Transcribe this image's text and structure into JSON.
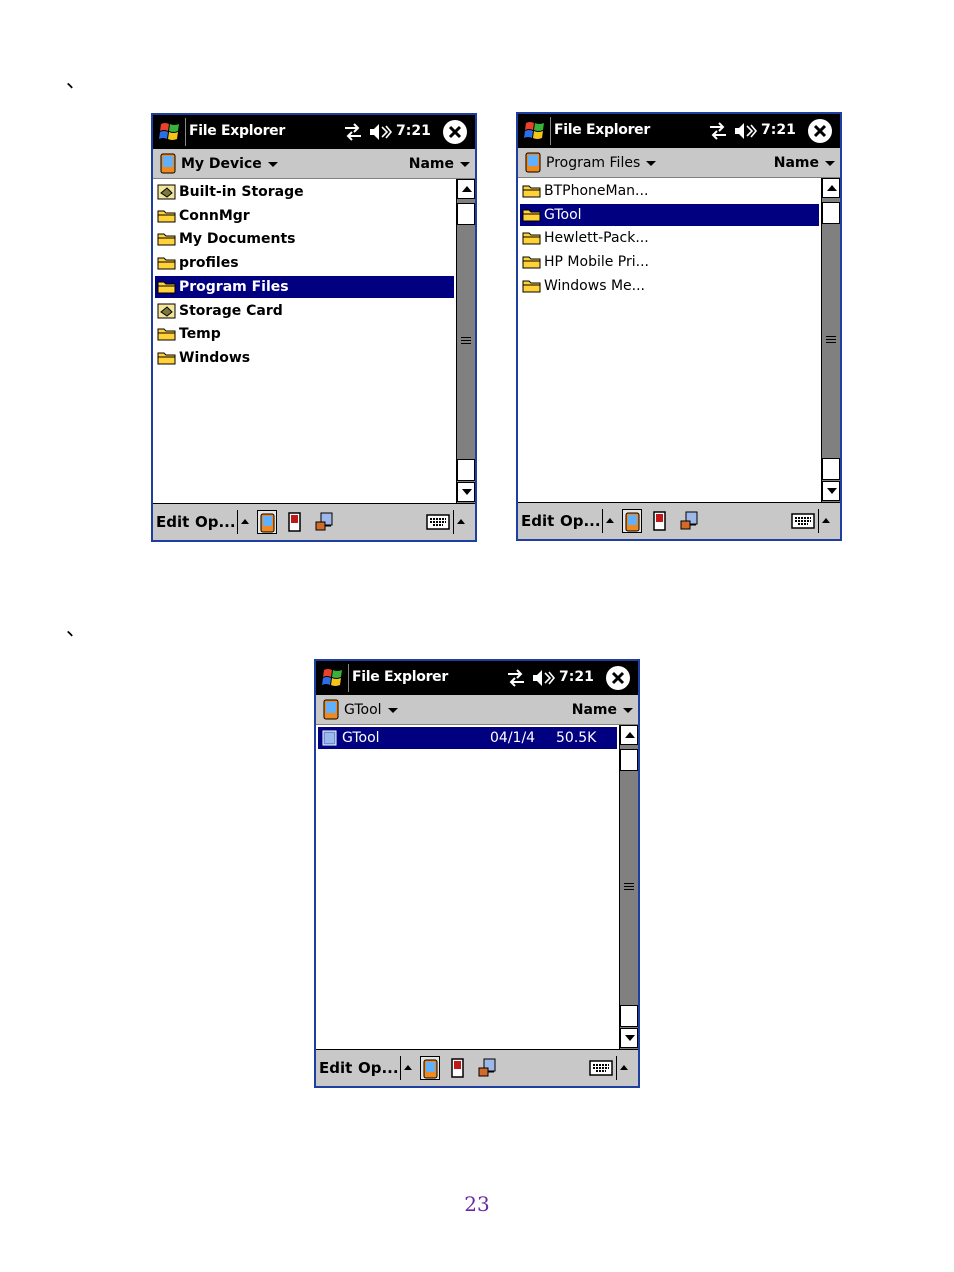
{
  "document": {
    "marks": [
      "、",
      "、"
    ],
    "page_number": "23"
  },
  "colors": {
    "titlebar": "#000000",
    "selection": "#000080",
    "bars": "#c8c8c8",
    "frame_border": "#1f3fa0",
    "page_number": "#6a2aa8"
  },
  "icons": [
    "windows-start-icon",
    "sync-icon",
    "volume-icon",
    "close-icon",
    "device-icon",
    "folder-icon",
    "storage-card-icon",
    "file-icon",
    "keyboard-icon",
    "up-folder-icon",
    "device-view-icon",
    "storage-view-icon",
    "network-view-icon"
  ],
  "screens": [
    {
      "title": "File Explorer",
      "time": "7:21",
      "location": "My Device",
      "sort": "Name",
      "items": [
        {
          "name": "Built-in Storage",
          "icon": "storage-card-icon",
          "selected": false
        },
        {
          "name": "ConnMgr",
          "icon": "folder-icon",
          "selected": false
        },
        {
          "name": "My Documents",
          "icon": "folder-icon",
          "selected": false
        },
        {
          "name": "profiles",
          "icon": "folder-icon",
          "selected": false
        },
        {
          "name": "Program Files",
          "icon": "folder-icon",
          "selected": true
        },
        {
          "name": "Storage Card",
          "icon": "storage-card-icon",
          "selected": false
        },
        {
          "name": "Temp",
          "icon": "folder-icon",
          "selected": false
        },
        {
          "name": "Windows",
          "icon": "folder-icon",
          "selected": false
        }
      ],
      "menu": {
        "edit": "Edit",
        "open": "Op..."
      }
    },
    {
      "title": "File Explorer",
      "time": "7:21",
      "location": "Program Files",
      "sort": "Name",
      "items": [
        {
          "name": "BTPhoneMan...",
          "icon": "folder-icon",
          "selected": false
        },
        {
          "name": "GTool",
          "icon": "folder-icon",
          "selected": true
        },
        {
          "name": "Hewlett-Pack...",
          "icon": "folder-icon",
          "selected": false
        },
        {
          "name": "HP Mobile Pri...",
          "icon": "folder-icon",
          "selected": false
        },
        {
          "name": "Windows Me...",
          "icon": "folder-icon",
          "selected": false
        }
      ],
      "menu": {
        "edit": "Edit",
        "open": "Op..."
      }
    },
    {
      "title": "File Explorer",
      "time": "7:21",
      "location": "GTool",
      "sort": "Name",
      "items": [
        {
          "name": "GTool",
          "icon": "file-icon",
          "date": "04/1/4",
          "size": "50.5K",
          "selected": true
        }
      ],
      "menu": {
        "edit": "Edit",
        "open": "Op..."
      }
    }
  ]
}
